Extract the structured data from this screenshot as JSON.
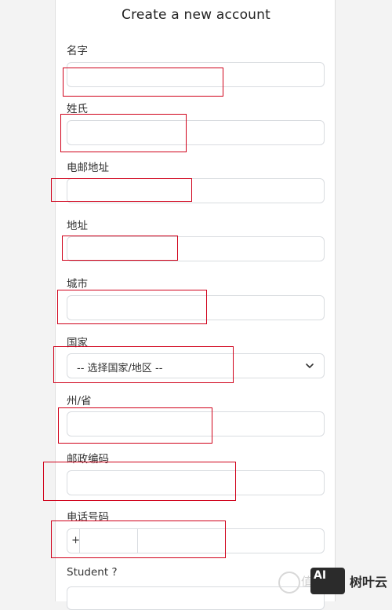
{
  "form": {
    "title": "Create a new account",
    "fields": {
      "first_name": {
        "label": "名字",
        "value": "",
        "placeholder": ""
      },
      "last_name": {
        "label": "姓氏",
        "value": "",
        "placeholder": ""
      },
      "email": {
        "label": "电邮地址",
        "value": "",
        "placeholder": ""
      },
      "address": {
        "label": "地址",
        "value": "",
        "placeholder": ""
      },
      "city": {
        "label": "城市",
        "value": "",
        "placeholder": ""
      },
      "country": {
        "label": "国家",
        "selected": "-- 选择国家/地区 --"
      },
      "state": {
        "label": "州/省",
        "value": "",
        "placeholder": ""
      },
      "postal_code": {
        "label": "邮政编码",
        "value": "",
        "placeholder": ""
      },
      "phone": {
        "label": "电话号码",
        "prefix": "+",
        "code": "",
        "number": ""
      },
      "student": {
        "label": "Student ?"
      }
    }
  },
  "icons": {
    "country_dropdown": "chevron-down-icon"
  },
  "colors": {
    "highlight": "#d0021b",
    "input_border": "#d9dce0",
    "page_bg": "#f3f3f3"
  },
  "watermark": {
    "logo_text": "AI",
    "name": "树叶云",
    "faint_text": "值"
  }
}
